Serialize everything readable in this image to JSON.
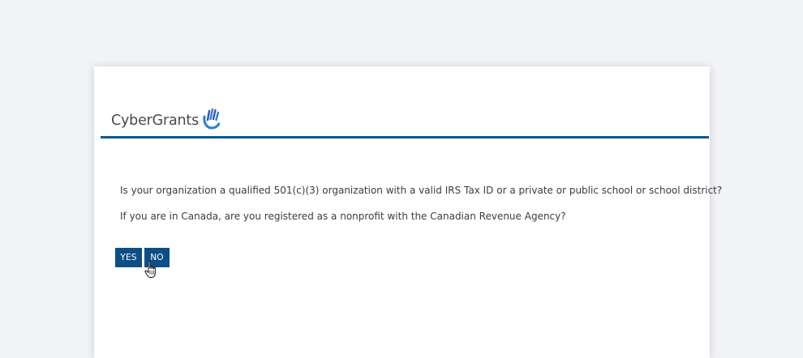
{
  "logo": {
    "text": "CyberGrants",
    "icon": "hand-wave-icon",
    "icon_color": "#2a7fd4"
  },
  "divider_color": "#0f5a8a",
  "questions": [
    "Is your organization a qualified 501(c)(3) organization with a valid IRS Tax ID or a private or public school or school district?",
    "If you are in Canada, are you registered as a nonprofit with the Canadian Revenue Agency?"
  ],
  "buttons": {
    "yes_label": "YES",
    "no_label": "NO",
    "color": "#0c4f86"
  },
  "cursor": "hand-pointer-icon"
}
